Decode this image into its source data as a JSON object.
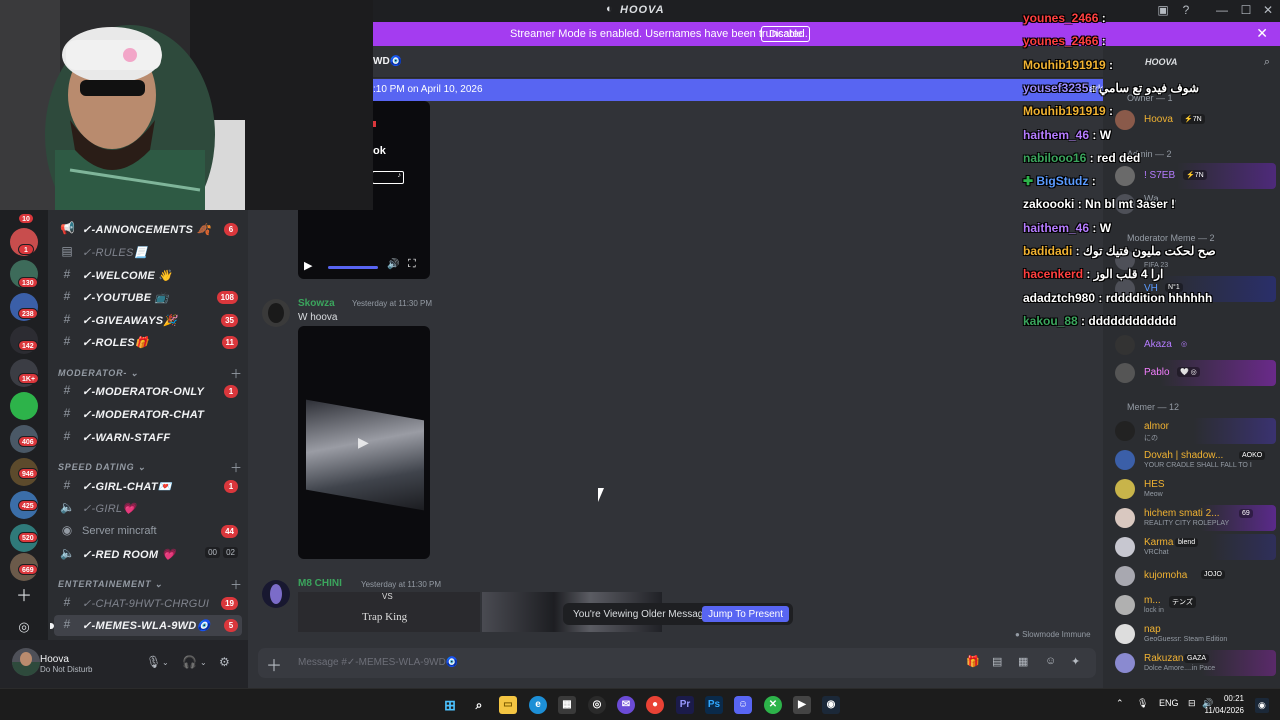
{
  "window": {
    "title": "HOOVA"
  },
  "banner": {
    "message": "Streamer Mode is enabled. Usernames have been truncated.",
    "disable_label": "Disable"
  },
  "chat": {
    "channel_fragment": "WD",
    "new_since": ":10 PM on April 10, 2026",
    "mark": "Mark",
    "tiktok_text": "ok",
    "messages": [
      {
        "author": "Skowza",
        "time": "Yesterday at 11:30 PM",
        "text": "W hoova"
      },
      {
        "author": "M8 CHINI",
        "time": "Yesterday at 11:30 PM",
        "embed_title": "Trap King",
        "embed_vs": "VS"
      }
    ],
    "older_notice": "You're Viewing Older Messages",
    "jump_label": "Jump To Present",
    "slowmode": "Slowmode Immune",
    "composer_placeholder": "Message #✓-MEMES-WLA-9WD🧿"
  },
  "sidebar": {
    "channels": [
      {
        "name": "✓-ANNONCEMENTS 🍂",
        "icon": "megaphone-icon",
        "badge": "6"
      },
      {
        "name": "✓-RULES📃",
        "icon": "rules-icon",
        "muted": true
      },
      {
        "name": "✓-WELCOME 👋",
        "icon": "hash-icon"
      },
      {
        "name": "✓-YOUTUBE 📺",
        "icon": "hash-icon",
        "badge": "108"
      },
      {
        "name": "✓-GIVEAWAYS🎉",
        "icon": "hash-icon",
        "badge": "35"
      },
      {
        "name": "✓-ROLES🎁",
        "icon": "hash-icon",
        "badge": "11"
      }
    ],
    "cat_moderator": "MODERATOR-",
    "moderator_channels": [
      {
        "name": "✓-MODERATOR-ONLY",
        "icon": "hash-icon",
        "badge": "1"
      },
      {
        "name": "✓-MODERATOR-CHAT",
        "icon": "hash-icon"
      },
      {
        "name": "✓-WARN-STAFF",
        "icon": "hash-icon"
      }
    ],
    "cat_speed": "SPEED DATING",
    "speed_channels": [
      {
        "name": "✓-GIRL-CHAT💌",
        "icon": "hash-icon",
        "badge": "1"
      },
      {
        "name": "✓-GIRL💗",
        "icon": "speaker-icon",
        "muted": true
      },
      {
        "name": "Server mincraft",
        "icon": "speaker-icon",
        "badge": "44",
        "plain": true
      },
      {
        "name": "✓-RED ROOM 💗",
        "icon": "speaker-icon",
        "count_a": "00",
        "count_b": "02"
      }
    ],
    "cat_ent": "ENTERTAINEMENT",
    "ent_channels": [
      {
        "name": "✓-CHAT-9HWT-CHRGUI",
        "icon": "hash-icon",
        "badge": "19",
        "muted": true
      },
      {
        "name": "✓-MEMES-WLA-9WD🧿",
        "icon": "hash-icon",
        "badge": "5",
        "active": true
      }
    ]
  },
  "rail": {
    "badges": [
      "10",
      "1",
      "130",
      "238",
      "142",
      "1K+",
      "406",
      "946",
      "425",
      "520",
      "669"
    ]
  },
  "user": {
    "name": "Hoova",
    "status": "Do Not Disturb"
  },
  "members": {
    "server_name": "HOOVA",
    "owner_cat": "Owner — 1",
    "owner": {
      "name": "Hoova",
      "tag": "⚡7N"
    },
    "admin_cat": "Admin — 2",
    "admins": [
      {
        "name": "! S7EB",
        "tag": "⚡7N"
      },
      {
        "name": "Wa",
        "sub": "ly"
      }
    ],
    "modmeme_cat": "Moderator Meme — 2",
    "modmemes": [
      {
        "name": "",
        "sub": "FIFA 23"
      },
      {
        "name": "VH",
        "tag": "N°1"
      }
    ],
    "others": [
      {
        "name": "Akaza",
        "tag": "◎"
      },
      {
        "name": "Pablo",
        "tag": "🤍 ◎"
      }
    ],
    "memer_cat": "Memer — 12",
    "memers": [
      {
        "name": "almor",
        "sub": "にの",
        "color": "#f0b232"
      },
      {
        "name": "Dovah | shadow...",
        "sub": "YOUR CRADLE SHALL FALL TO I",
        "tag": "AOKO",
        "color": "#f0b232"
      },
      {
        "name": "HES",
        "sub": "Meow",
        "color": "#f0b232"
      },
      {
        "name": "hichem smati 2...",
        "sub": "REALITY CITY ROLEPLAY",
        "tag": "69",
        "color": "#f0b232"
      },
      {
        "name": "Karma",
        "sub": "VRChat",
        "tag": "blend",
        "color": "#f0b232"
      },
      {
        "name": "kujomoha",
        "sub": "",
        "tag": "JOJO",
        "color": "#f0b232"
      },
      {
        "name": "m...",
        "sub": "lock in",
        "tag": "テンズ",
        "color": "#f0b232"
      },
      {
        "name": "nap",
        "sub": "GeoGuessr: Steam Edition",
        "color": "#f0b232"
      },
      {
        "name": "Rakuzan",
        "sub": "Dolce Amore....in Pace",
        "tag": "GAZA",
        "color": "#f0b232"
      }
    ]
  },
  "stream_chat": [
    {
      "user": "younes_2466",
      "color": "#ff4040",
      "text": ""
    },
    {
      "user": "younes_2466",
      "color": "#ff4040",
      "text": ""
    },
    {
      "user": "Mouhib191919",
      "color": "#f0b232",
      "text": ""
    },
    {
      "user": "yousef3235",
      "color": "#9b8cff",
      "text": "شوف فيدو تع سامي"
    },
    {
      "user": "Mouhib191919",
      "color": "#f0b232",
      "text": ""
    },
    {
      "user": "haithem_46",
      "color": "#b57cff",
      "text": "W"
    },
    {
      "user": "nabilooo16",
      "color": "#3ba55d",
      "text": "red ded"
    },
    {
      "user": "BigStudz",
      "color": "#5b9bff",
      "text": ""
    },
    {
      "user": "zakoooki",
      "color": "#ffffff",
      "text": "Nn bl mt 3aser !"
    },
    {
      "user": "haithem_46",
      "color": "#b57cff",
      "text": "W"
    },
    {
      "user": "badidadi",
      "color": "#f0b232",
      "text": "صح لحكت مليون فتيك توك"
    },
    {
      "user": "hacenkerd",
      "color": "#ff4040",
      "text": "ارا 4 قلب الوز"
    },
    {
      "user": "adadztch980",
      "color": "#ffffff",
      "text": "rddddition hhhhhh"
    },
    {
      "user": "kakou_88",
      "color": "#3ba55d",
      "text": "dddddddddddd"
    }
  ],
  "taskbar": {
    "lang": "ENG",
    "time": "00:21",
    "date": "11/04/2026"
  }
}
